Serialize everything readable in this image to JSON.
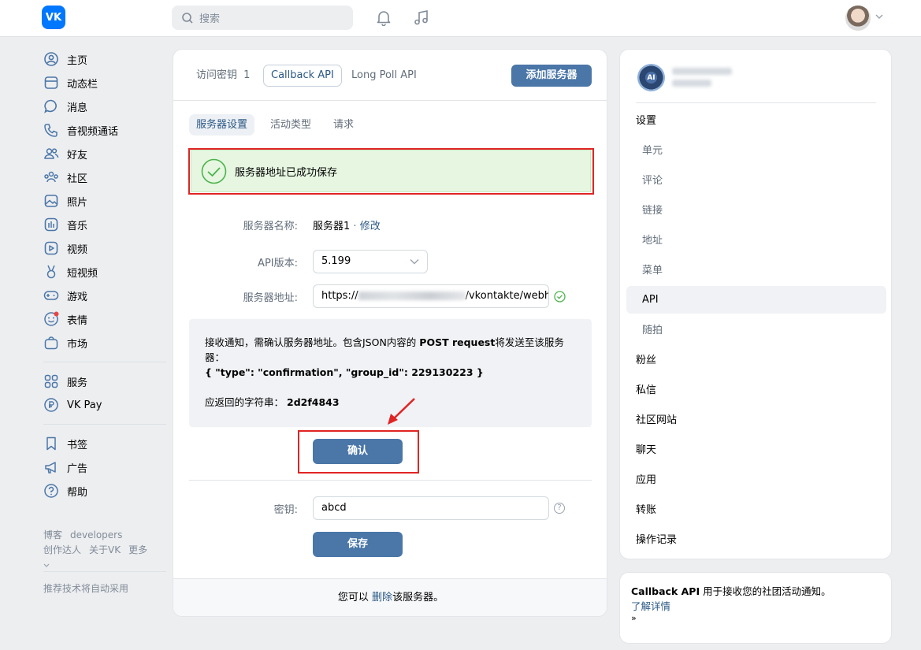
{
  "header": {
    "logo": "VK",
    "search_placeholder": "搜索"
  },
  "nav": {
    "items": [
      {
        "label": "主页",
        "icon": "user-circle-icon"
      },
      {
        "label": "动态栏",
        "icon": "newsfeed-icon"
      },
      {
        "label": "消息",
        "icon": "message-icon"
      },
      {
        "label": "音视频通话",
        "icon": "phone-icon"
      },
      {
        "label": "好友",
        "icon": "friends-icon"
      },
      {
        "label": "社区",
        "icon": "community-icon"
      },
      {
        "label": "照片",
        "icon": "photo-icon"
      },
      {
        "label": "音乐",
        "icon": "music-icon"
      },
      {
        "label": "视频",
        "icon": "video-icon"
      },
      {
        "label": "短视频",
        "icon": "clips-icon"
      },
      {
        "label": "游戏",
        "icon": "gamepad-icon"
      },
      {
        "label": "表情",
        "icon": "smile-icon"
      },
      {
        "label": "市场",
        "icon": "market-icon"
      }
    ],
    "items2": [
      {
        "label": "服务",
        "icon": "services-icon"
      },
      {
        "label": "VK Pay",
        "icon": "vkpay-icon"
      }
    ],
    "items3": [
      {
        "label": "书签",
        "icon": "bookmark-icon"
      },
      {
        "label": "广告",
        "icon": "megaphone-icon"
      },
      {
        "label": "帮助",
        "icon": "help-icon"
      }
    ],
    "footer": {
      "blog": "博客",
      "developers": "developers",
      "creators": "创作达人",
      "about": "关于VK",
      "more": "更多"
    },
    "footer_note": "推荐技术将自动采用"
  },
  "main": {
    "tabs": [
      {
        "label": "访问密钥",
        "count": "1"
      },
      {
        "label": "Callback API"
      },
      {
        "label": "Long Poll API"
      }
    ],
    "add_server_button": "添加服务器",
    "subtabs": [
      "服务器设置",
      "活动类型",
      "请求"
    ],
    "success_message": "服务器地址已成功保存",
    "server_name_label": "服务器名称:",
    "server_name_value": "服务器1",
    "server_name_sep": " · ",
    "server_name_edit": "修改",
    "api_version_label": "API版本:",
    "api_version_value": "5.199",
    "server_address_label": "服务器地址:",
    "server_address_prefix": "https://",
    "server_address_suffix": "/vkontakte/webhc",
    "info": {
      "line1_a": "接收通知，需确认服务器地址。包含JSON内容的 ",
      "line1_b": "POST request",
      "line1_c": "将发送至该服务器：",
      "json": "{ \"type\": \"confirmation\", \"group_id\": 229130223 }",
      "return_label": "应返回的字符串：",
      "return_value": "2d2f4843"
    },
    "confirm_button": "确认",
    "secret_label": "密钥:",
    "secret_value": "abcd",
    "save_button": "保存",
    "footer_prefix": "您可以 ",
    "footer_link": "删除",
    "footer_suffix": "该服务器。"
  },
  "right": {
    "group_avatar_text": "AI",
    "menu": [
      {
        "label": "设置",
        "level": "top"
      },
      {
        "label": "单元",
        "level": "sub"
      },
      {
        "label": "评论",
        "level": "sub"
      },
      {
        "label": "链接",
        "level": "sub"
      },
      {
        "label": "地址",
        "level": "sub"
      },
      {
        "label": "菜单",
        "level": "sub"
      },
      {
        "label": "API",
        "level": "sub",
        "selected": true
      },
      {
        "label": "随拍",
        "level": "sub"
      },
      {
        "label": "粉丝",
        "level": "top"
      },
      {
        "label": "私信",
        "level": "top"
      },
      {
        "label": "社区网站",
        "level": "top"
      },
      {
        "label": "聊天",
        "level": "top"
      },
      {
        "label": "应用",
        "level": "top"
      },
      {
        "label": "转账",
        "level": "top"
      },
      {
        "label": "操作记录",
        "level": "top"
      }
    ]
  },
  "info_box": {
    "title_bold": "Callback API",
    "title_rest": " 用于接收您的社团活动通知。",
    "link": "了解详情",
    "arrow": "»"
  },
  "colors": {
    "accent": "#4a76a8",
    "brand": "#0077ff",
    "success_bg": "#e6f6e1",
    "annotation_red": "#e02424"
  }
}
